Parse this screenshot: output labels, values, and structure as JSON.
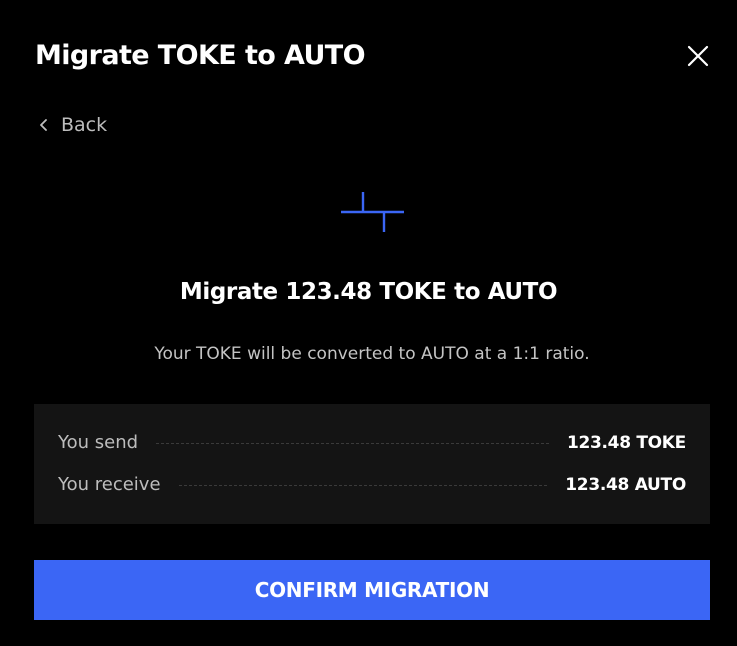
{
  "modal": {
    "title": "Migrate TOKE to AUTO",
    "close_icon": "close-icon"
  },
  "back": {
    "icon": "chevron-left-icon",
    "label": "Back"
  },
  "logo": {
    "icon": "auto-logo-icon",
    "color": "#3b66f5"
  },
  "migration": {
    "heading": "Migrate 123.48 TOKE to AUTO",
    "description": "Your TOKE will be converted to AUTO at a 1:1 ratio."
  },
  "summary": {
    "rows": [
      {
        "label": "You send",
        "value": "123.48 TOKE"
      },
      {
        "label": "You receive",
        "value": "123.48 AUTO"
      }
    ]
  },
  "actions": {
    "confirm_label": "CONFIRM MIGRATION"
  },
  "colors": {
    "background": "#000000",
    "panel": "#141414",
    "accent": "#3b66f5",
    "text_primary": "#ffffff",
    "text_secondary": "#bdbdbd"
  }
}
